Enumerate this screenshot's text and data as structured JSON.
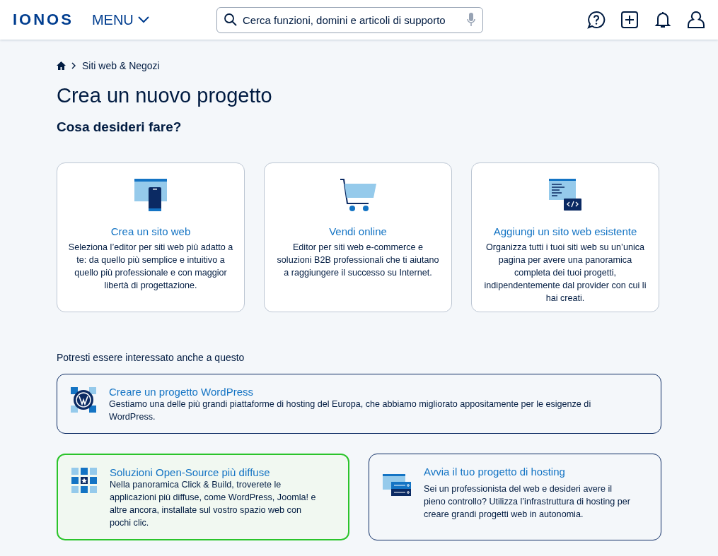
{
  "header": {
    "logo": "IONOS",
    "menu": "MENU",
    "search": {
      "placeholder": "Cerca funzioni, domini e articoli di supporto"
    }
  },
  "breadcrumb": [
    "Siti web & Negozi"
  ],
  "title": "Crea un nuovo progetto",
  "subtitle": "Cosa desideri fare?",
  "cards": [
    {
      "kind": "website",
      "title": "Crea un sito web",
      "text": "Seleziona l’editor per siti web più adatto a te: da quello più semplice e intuitivo a quello più professionale e con maggior libertà di progettazione."
    },
    {
      "kind": "shop",
      "title": "Vendi online",
      "text": "Editor per siti web e-commerce e soluzioni B2B professionali che ti aiutano a raggiungere il successo su Internet."
    },
    {
      "kind": "existing",
      "title": "Aggiungi un sito web esistente",
      "text": "Organizza tutti i tuoi siti web su un’unica pagina per avere una panoramica completa dei tuoi progetti, indipendentemente dal provider con cui li hai creati."
    }
  ],
  "suggestions_label": "Potresti essere interessato anche a questo",
  "suggestions": [
    {
      "kind": "wordpress",
      "selected": false,
      "title": "Creare un progetto WordPress",
      "text": "Gestiamo una delle più grandi piattaforme di hosting del Europa, che abbiamo migliorato appositamente per le esigenze di WordPress."
    },
    {
      "kind": "opensource",
      "selected": true,
      "title": "Soluzioni Open-Source più diffuse",
      "text": "Nella panoramica Click & Build, troverete le applicazioni più diffuse, come WordPress, Joomla! e altre ancora, installate sul vostro spazio web con pochi clic."
    },
    {
      "kind": "hosting",
      "selected": false,
      "title": "Avvia il tuo progetto di hosting",
      "text": "Sei un professionista del web e desideri avere il pieno controllo? Utilizza l’infrastruttura di hosting per creare grandi progetti web in autonomia."
    }
  ]
}
